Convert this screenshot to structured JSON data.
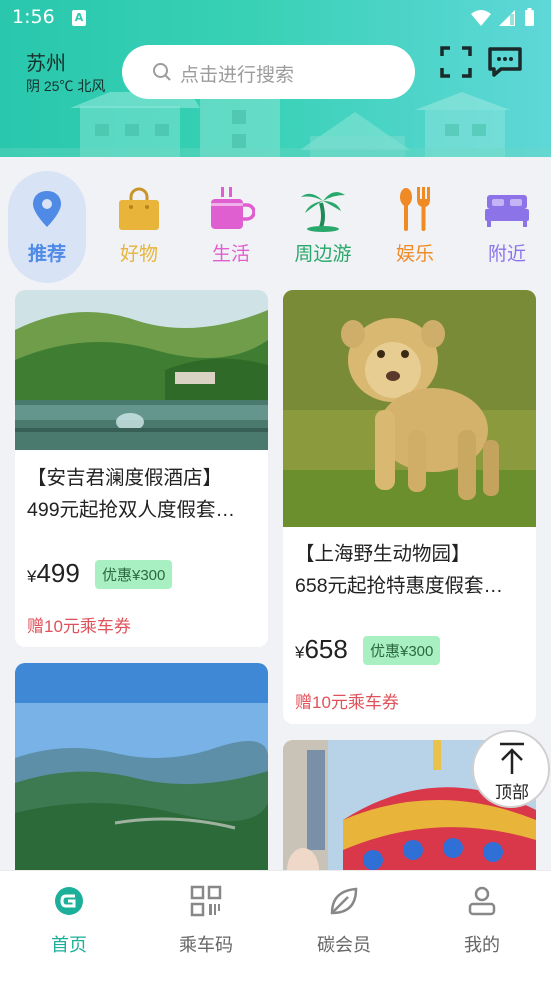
{
  "status_bar": {
    "time": "1:56",
    "notification_glyph": "A",
    "icons": [
      "wifi-icon",
      "signal-icon",
      "battery-icon"
    ]
  },
  "header": {
    "city": "苏州",
    "weather": "阴 25℃ 北风",
    "search_placeholder": "点击进行搜索",
    "icons": [
      "scan-icon",
      "message-icon"
    ]
  },
  "categories": [
    {
      "label": "推荐",
      "icon": "location-pin-icon",
      "color": "#4e8ae6",
      "active": true
    },
    {
      "label": "好物",
      "icon": "shopping-bag-icon",
      "color": "#e8b43a",
      "active": false
    },
    {
      "label": "生活",
      "icon": "coffee-cup-icon",
      "color": "#e05fd0",
      "active": false
    },
    {
      "label": "周边游",
      "icon": "palm-tree-icon",
      "color": "#28a86a",
      "active": false
    },
    {
      "label": "娱乐",
      "icon": "utensils-icon",
      "color": "#f08a24",
      "active": false
    },
    {
      "label": "附近",
      "icon": "bed-icon",
      "color": "#8c74e8",
      "active": false
    }
  ],
  "feed": {
    "cards": [
      {
        "title_line1": "【安吉君澜度假酒店】",
        "title_line2": "499元起抢双人度假套…",
        "currency": "¥",
        "price": "499",
        "discount": "优惠¥300",
        "promo": "赠10元乘车券",
        "image": "hot-spring-mountain-photo"
      },
      {
        "title_line1": "【上海野生动物园】",
        "title_line2": "658元起抢特惠度假套…",
        "currency": "¥",
        "price": "658",
        "discount": "优惠¥300",
        "promo": "赠10元乘车券",
        "image": "lion-cub-photo"
      },
      {
        "image": "mountain-valley-photo"
      },
      {
        "image": "carousel-photo"
      }
    ]
  },
  "back_to_top": {
    "label": "顶部"
  },
  "bottom_nav": [
    {
      "label": "首页",
      "icon": "home-logo-icon",
      "active": true
    },
    {
      "label": "乘车码",
      "icon": "qr-code-icon",
      "active": false
    },
    {
      "label": "碳会员",
      "icon": "leaf-icon",
      "active": false
    },
    {
      "label": "我的",
      "icon": "person-icon",
      "active": false
    }
  ],
  "colors": {
    "accent": "#1cb09a",
    "header_start": "#29c7ad",
    "header_end": "#5fd7d8",
    "promo_red": "#e0525a",
    "badge_green": "#a8f0c2"
  }
}
